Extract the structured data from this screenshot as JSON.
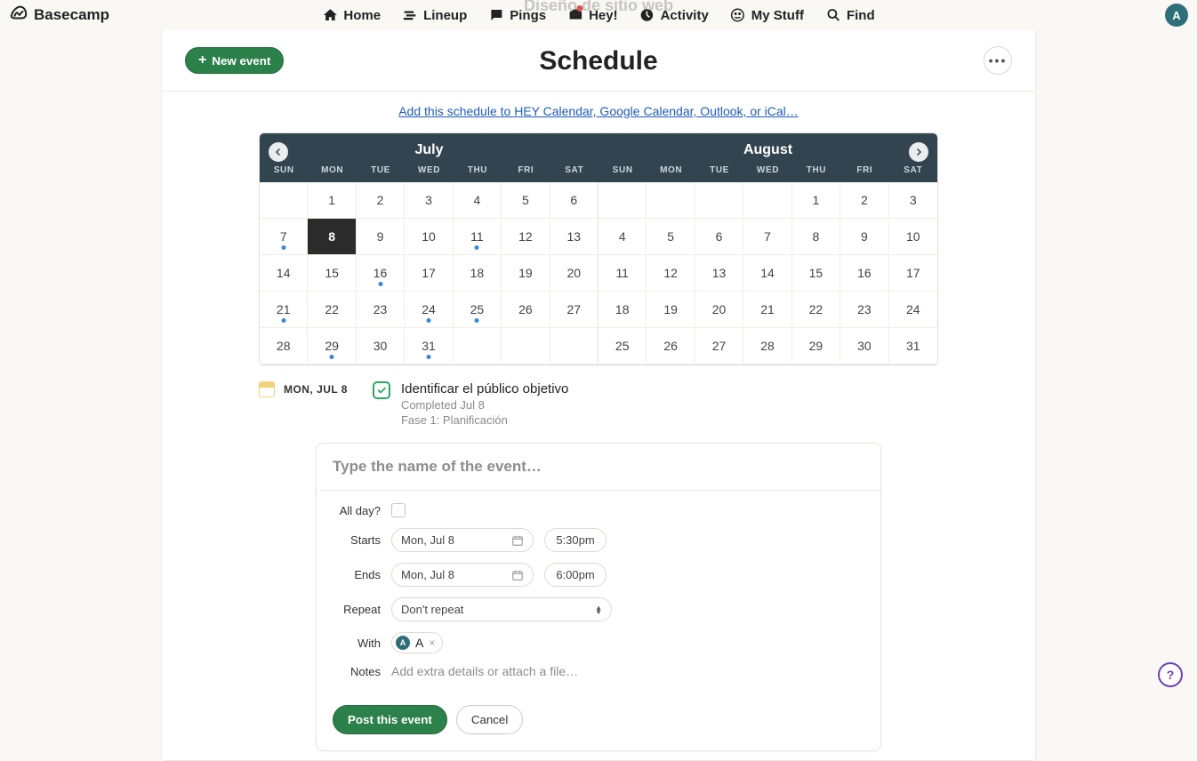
{
  "brand": "Basecamp",
  "project_ghost": "Diseño de sitio web",
  "nav": {
    "home": "Home",
    "lineup": "Lineup",
    "pings": "Pings",
    "hey": "Hey!",
    "activity": "Activity",
    "mystuff": "My Stuff",
    "find": "Find"
  },
  "avatar_letter": "A",
  "header": {
    "new_event": "New event",
    "title": "Schedule"
  },
  "schedule_link": "Add this schedule to HEY Calendar, Google Calendar, Outlook, or iCal…",
  "calendar": {
    "dow": [
      "SUN",
      "MON",
      "TUE",
      "WED",
      "THU",
      "FRI",
      "SAT"
    ],
    "months": [
      {
        "name": "July",
        "weeks": [
          [
            "",
            "1",
            "2",
            "3",
            "4",
            "5",
            "6"
          ],
          [
            "7",
            "8",
            "9",
            "10",
            "11",
            "12",
            "13"
          ],
          [
            "14",
            "15",
            "16",
            "17",
            "18",
            "19",
            "20"
          ],
          [
            "21",
            "22",
            "23",
            "24",
            "25",
            "26",
            "27"
          ],
          [
            "28",
            "29",
            "30",
            "31",
            "",
            "",
            ""
          ]
        ],
        "dots": [
          "7",
          "11",
          "16",
          "21",
          "24",
          "25",
          "29",
          "31"
        ],
        "selected": "8"
      },
      {
        "name": "August",
        "weeks": [
          [
            "",
            "",
            "",
            "",
            "1",
            "2",
            "3"
          ],
          [
            "4",
            "5",
            "6",
            "7",
            "8",
            "9",
            "10"
          ],
          [
            "11",
            "12",
            "13",
            "14",
            "15",
            "16",
            "17"
          ],
          [
            "18",
            "19",
            "20",
            "21",
            "22",
            "23",
            "24"
          ],
          [
            "25",
            "26",
            "27",
            "28",
            "29",
            "30",
            "31"
          ]
        ],
        "dots": [],
        "selected": null
      }
    ]
  },
  "today": {
    "date_label": "MON, JUL 8",
    "todo_title": "Identificar el público objetivo",
    "todo_sub1": "Completed Jul 8",
    "todo_sub2": "Fase 1: Planificación"
  },
  "form": {
    "name_placeholder": "Type the name of the event…",
    "labels": {
      "all_day": "All day?",
      "starts": "Starts",
      "ends": "Ends",
      "repeat": "Repeat",
      "with": "With",
      "notes": "Notes"
    },
    "starts_date": "Mon, Jul 8",
    "starts_time": "5:30pm",
    "ends_date": "Mon, Jul 8",
    "ends_time": "6:00pm",
    "repeat_value": "Don't repeat",
    "with_name": "A",
    "notes_placeholder": "Add extra details or attach a file…",
    "post": "Post this event",
    "cancel": "Cancel"
  },
  "help": "?"
}
